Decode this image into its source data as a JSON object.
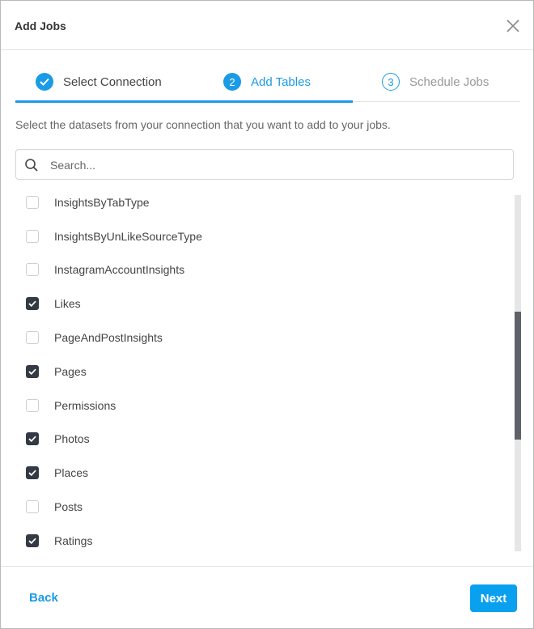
{
  "dialog": {
    "title": "Add Jobs"
  },
  "steps": [
    {
      "label": "Select Connection",
      "marker": "✓",
      "state": "done"
    },
    {
      "label": "Add Tables",
      "marker": "2",
      "state": "active"
    },
    {
      "label": "Schedule Jobs",
      "marker": "3",
      "state": "todo"
    }
  ],
  "description": "Select the datasets from your connection that you want to add to your jobs.",
  "search": {
    "placeholder": "Search...",
    "value": ""
  },
  "datasets": [
    {
      "label": "InsightsByTabType",
      "checked": false
    },
    {
      "label": "InsightsByUnLikeSourceType",
      "checked": false
    },
    {
      "label": "InstagramAccountInsights",
      "checked": false
    },
    {
      "label": "Likes",
      "checked": true
    },
    {
      "label": "PageAndPostInsights",
      "checked": false
    },
    {
      "label": "Pages",
      "checked": true
    },
    {
      "label": "Permissions",
      "checked": false
    },
    {
      "label": "Photos",
      "checked": true
    },
    {
      "label": "Places",
      "checked": true
    },
    {
      "label": "Posts",
      "checked": false
    },
    {
      "label": "Ratings",
      "checked": true
    }
  ],
  "footer": {
    "back_label": "Back",
    "next_label": "Next"
  },
  "colors": {
    "accent": "#1a9be6",
    "checkbox_checked": "#343a44",
    "scroll_thumb": "#5f6268"
  }
}
